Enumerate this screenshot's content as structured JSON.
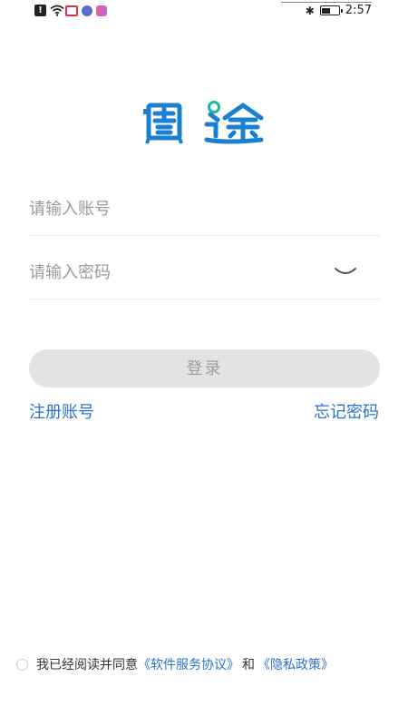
{
  "status_bar": {
    "time": "2:57",
    "alert_glyph": "!",
    "icons": [
      "alert-icon",
      "wifi-icon",
      "app-notification-icon",
      "app-circle-icon",
      "app-pink-icon",
      "bluetooth-icon",
      "battery-icon"
    ],
    "bluetooth_glyph": "✱"
  },
  "login": {
    "account_placeholder": "请输入账号",
    "password_placeholder": "请输入密码",
    "login_label": "登录",
    "register_link": "注册账号",
    "forgot_link": "忘记密码"
  },
  "agreement": {
    "prefix": "我已经阅读并同意",
    "terms_link": "《软件服务协议》",
    "conjunction": "和",
    "privacy_link": "《隐私政策》"
  },
  "colors": {
    "brand_blue": "#1a7fd1",
    "link_blue": "#2b73c7",
    "accent_green": "#1bb6a5",
    "button_disabled_bg": "#e3e3e3"
  }
}
